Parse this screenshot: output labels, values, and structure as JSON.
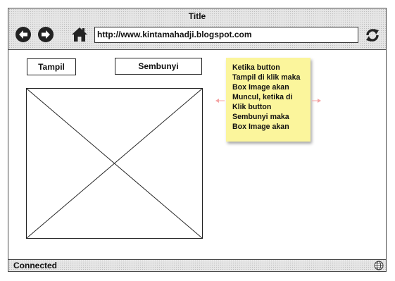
{
  "window": {
    "title": "Title"
  },
  "toolbar": {
    "back_icon": "back-arrow-icon",
    "forward_icon": "forward-arrow-icon",
    "home_icon": "home-icon",
    "refresh_icon": "refresh-icon",
    "url": "http://www.kintamahadji.blogspot.com"
  },
  "content": {
    "show_button_label": "Tampil",
    "hide_button_label": "Sembunyi",
    "image_placeholder_icon": "image-placeholder",
    "note": {
      "lines": [
        "Ketika button",
        "Tampil di klik maka",
        "Box Image akan",
        "Muncul, ketika di",
        "Klik button",
        "Sembunyi maka",
        "Box Image akan"
      ],
      "color": "#fbf59c"
    }
  },
  "status": {
    "text": "Connected",
    "icon": "globe-icon"
  }
}
